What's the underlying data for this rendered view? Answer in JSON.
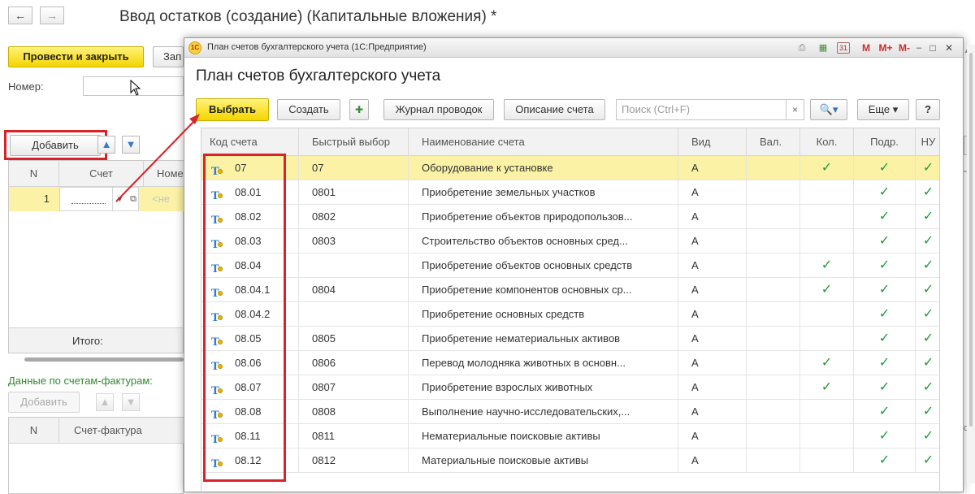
{
  "bg": {
    "title": "Ввод остатков (создание) (Капитальные вложения) *",
    "post_close": "Провести и закрыть",
    "write_partial": "Зап",
    "number_label": "Номер:",
    "add": "Добавить",
    "cols": {
      "n": "N",
      "account": "Счет",
      "nom_partial": "Номе"
    },
    "row1": {
      "n": "1",
      "placeholder_partial": "<не"
    },
    "total": "Итого:",
    "invoices_label": "Данные по счетам-фактурам:",
    "add2": "Добавить",
    "cols2": {
      "n": "N",
      "invoice": "Счет-фактура"
    },
    "right_partial": {
      "nu": "НУ",
      "other": "ом"
    }
  },
  "modal": {
    "window_title": "План счетов бухгалтерского учета  (1С:Предприятие)",
    "logo": "1С",
    "tb_icons": {
      "m": "M",
      "mplus": "M+",
      "mminus": "M-",
      "min": "–",
      "max": "□",
      "close": "✕",
      "cal": "31"
    },
    "heading": "План счетов бухгалтерского учета",
    "toolbar": {
      "select": "Выбрать",
      "create": "Создать",
      "journal": "Журнал проводок",
      "description": "Описание счета",
      "search_placeholder": "Поиск (Ctrl+F)",
      "search_clear": "×",
      "more": "Еще ▾",
      "help": "?"
    },
    "columns": [
      "Код счета",
      "Быстрый выбор",
      "Наименование счета",
      "Вид",
      "Вал.",
      "Кол.",
      "Подр.",
      "НУ"
    ],
    "rows": [
      {
        "code": "07",
        "quick": "07",
        "name": "Оборудование к установке",
        "kind": "А",
        "val": false,
        "qty": true,
        "dept": true,
        "nu": true,
        "selected": true
      },
      {
        "code": "08.01",
        "quick": "0801",
        "name": "Приобретение земельных участков",
        "kind": "А",
        "val": false,
        "qty": false,
        "dept": true,
        "nu": true
      },
      {
        "code": "08.02",
        "quick": "0802",
        "name": "Приобретение объектов природопользов...",
        "kind": "А",
        "val": false,
        "qty": false,
        "dept": true,
        "nu": true
      },
      {
        "code": "08.03",
        "quick": "0803",
        "name": "Строительство объектов основных сред...",
        "kind": "А",
        "val": false,
        "qty": false,
        "dept": true,
        "nu": true
      },
      {
        "code": "08.04",
        "quick": "",
        "name": "Приобретение объектов основных средств",
        "kind": "А",
        "val": false,
        "qty": true,
        "dept": true,
        "nu": true
      },
      {
        "code": "08.04.1",
        "quick": "0804",
        "name": "Приобретение компонентов основных ср...",
        "kind": "А",
        "val": false,
        "qty": true,
        "dept": true,
        "nu": true
      },
      {
        "code": "08.04.2",
        "quick": "",
        "name": "Приобретение основных средств",
        "kind": "А",
        "val": false,
        "qty": false,
        "dept": true,
        "nu": true
      },
      {
        "code": "08.05",
        "quick": "0805",
        "name": "Приобретение нематериальных активов",
        "kind": "А",
        "val": false,
        "qty": false,
        "dept": true,
        "nu": true
      },
      {
        "code": "08.06",
        "quick": "0806",
        "name": "Перевод молодняка животных в основн...",
        "kind": "А",
        "val": false,
        "qty": true,
        "dept": true,
        "nu": true
      },
      {
        "code": "08.07",
        "quick": "0807",
        "name": "Приобретение взрослых животных",
        "kind": "А",
        "val": false,
        "qty": true,
        "dept": true,
        "nu": true
      },
      {
        "code": "08.08",
        "quick": "0808",
        "name": "Выполнение научно-исследовательских,...",
        "kind": "А",
        "val": false,
        "qty": false,
        "dept": true,
        "nu": true
      },
      {
        "code": "08.11",
        "quick": "0811",
        "name": "Нематериальные поисковые активы",
        "kind": "А",
        "val": false,
        "qty": false,
        "dept": true,
        "nu": true
      },
      {
        "code": "08.12",
        "quick": "0812",
        "name": "Материальные поисковые активы",
        "kind": "А",
        "val": false,
        "qty": false,
        "dept": true,
        "nu": true
      }
    ],
    "check_glyph": "✓"
  },
  "colors": {
    "accent_yellow": "#f5d500",
    "selected_row": "#fbf2a5",
    "check_green": "#1e9a3a",
    "highlight_red": "#d9222a"
  }
}
